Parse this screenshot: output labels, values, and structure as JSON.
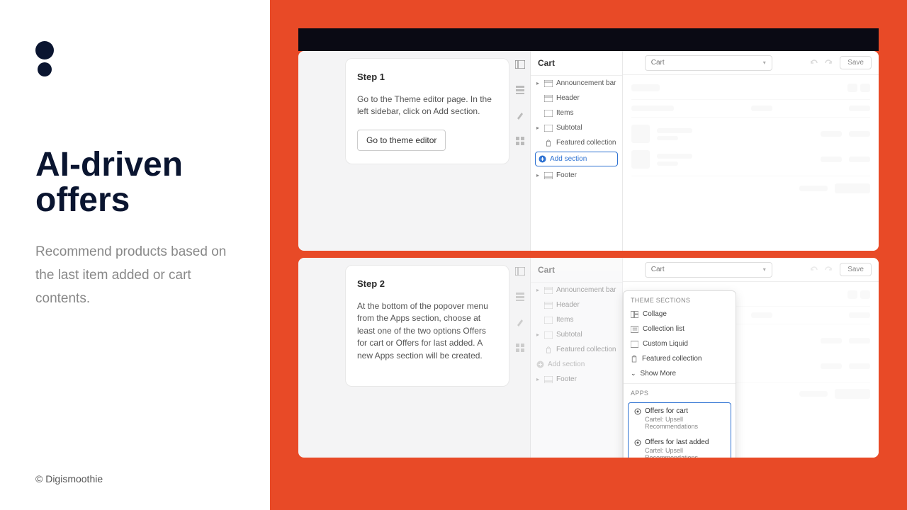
{
  "left": {
    "heading": "AI-driven offers",
    "subtext": "Recommend products based on the last item added or cart contents.",
    "copyright": "© Digismoothie"
  },
  "step1": {
    "title": "Step 1",
    "desc": "Go to the Theme editor page. In the left sidebar, click on Add section.",
    "button": "Go to theme editor",
    "dropdown": "Cart",
    "save": "Save",
    "panel_title": "Cart",
    "sections": {
      "announcement": "Announcement bar",
      "header": "Header",
      "items": "Items",
      "subtotal": "Subtotal",
      "featured": "Featured collection",
      "add": "Add section",
      "footer": "Footer"
    }
  },
  "step2": {
    "title": "Step 2",
    "desc": "At the bottom of the popover menu from the Apps section, choose at least one of the two options Offers for cart or Offers for last added. A new Apps section will be created.",
    "dropdown": "Cart",
    "save": "Save",
    "panel_title": "Cart",
    "sections": {
      "announcement": "Announcement bar",
      "header": "Header",
      "items": "Items",
      "subtotal": "Subtotal",
      "featured": "Featured collection",
      "add": "Add section",
      "footer": "Footer"
    },
    "popover": {
      "theme_label": "THEME SECTIONS",
      "collage": "Collage",
      "collection_list": "Collection list",
      "custom_liquid": "Custom Liquid",
      "featured": "Featured collection",
      "show_more": "Show More",
      "apps_label": "APPS",
      "offers_cart": "Offers for cart",
      "offers_cart_sub": "Cartel: Upsell Recommendations",
      "offers_last": "Offers for last added",
      "offers_last_sub": "Cartel: Upsell Recommendations"
    }
  }
}
